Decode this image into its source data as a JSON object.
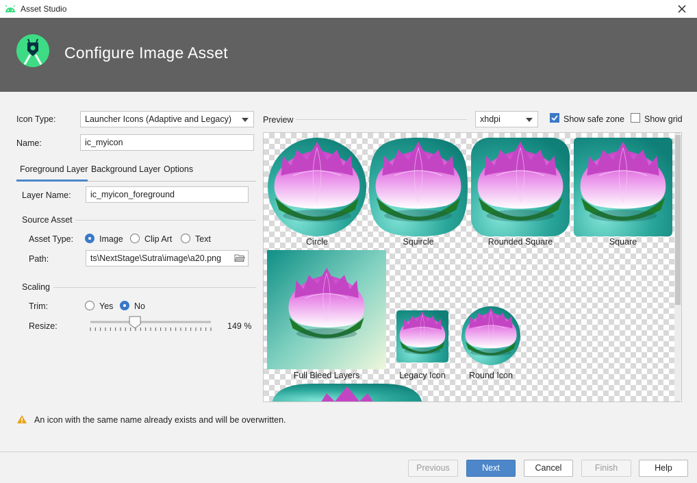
{
  "window": {
    "title": "Asset Studio"
  },
  "header": {
    "title": "Configure Image Asset"
  },
  "form": {
    "icon_type_label": "Icon Type:",
    "icon_type_value": "Launcher Icons (Adaptive and Legacy)",
    "name_label": "Name:",
    "name_value": "ic_myicon",
    "tabs": [
      {
        "label": "Foreground Layer",
        "selected": true
      },
      {
        "label": "Background Layer",
        "selected": false
      },
      {
        "label": "Options",
        "selected": false
      }
    ],
    "layer_name_label": "Layer Name:",
    "layer_name_value": "ic_myicon_foreground",
    "source_asset_heading": "Source Asset",
    "asset_type_label": "Asset Type:",
    "asset_type_options": [
      "Image",
      "Clip Art",
      "Text"
    ],
    "asset_type_selected": "Image",
    "path_label": "Path:",
    "path_value": "ts\\NextStage\\Sutra\\image\\a20.png",
    "scaling_heading": "Scaling",
    "trim_label": "Trim:",
    "trim_options": [
      "Yes",
      "No"
    ],
    "trim_selected": "No",
    "resize_label": "Resize:",
    "resize_value": "149 %",
    "resize_fraction": 0.37
  },
  "preview": {
    "label": "Preview",
    "density_value": "xhdpi",
    "show_safe_zone_label": "Show safe zone",
    "show_safe_zone_checked": true,
    "show_grid_label": "Show grid",
    "show_grid_checked": false,
    "icons": [
      {
        "caption": "Circle",
        "shape": "circle"
      },
      {
        "caption": "Squircle",
        "shape": "squircle"
      },
      {
        "caption": "Rounded Square",
        "shape": "rounded-square"
      },
      {
        "caption": "Square",
        "shape": "square"
      },
      {
        "caption": "Full Bleed Layers",
        "shape": "full-bleed"
      },
      {
        "caption": "Legacy Icon",
        "shape": "legacy"
      },
      {
        "caption": "Round Icon",
        "shape": "round"
      }
    ]
  },
  "warning": {
    "text": "An icon with the same name already exists and will be overwritten.",
    "icon": "warning-triangle-icon"
  },
  "buttons": {
    "previous": "Previous",
    "next": "Next",
    "cancel": "Cancel",
    "finish": "Finish",
    "help": "Help"
  },
  "colors": {
    "header_bg": "#616161",
    "accent": "#3a79c7",
    "android_green": "#3ddc84",
    "lotus_pink": "#d65ad6",
    "leaf_green": "#1f7a2a",
    "teal_bg": "#2ea89c"
  }
}
